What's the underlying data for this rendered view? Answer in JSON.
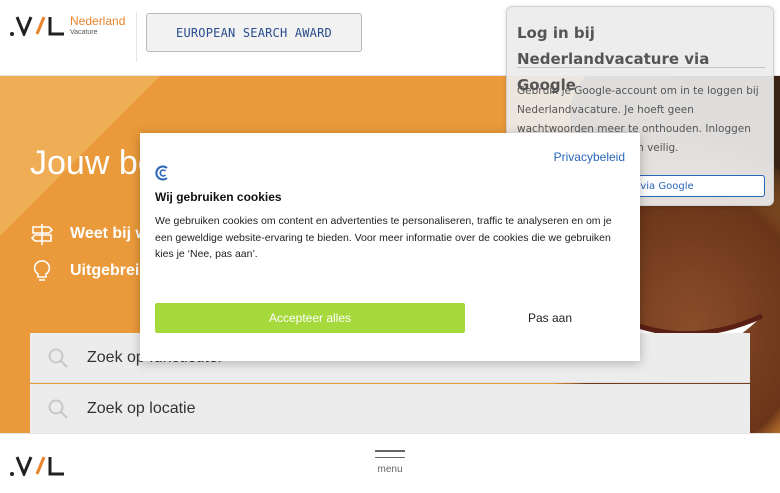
{
  "colors": {
    "brand_orange": "#ea9a3a",
    "accept_green": "#a6d93c",
    "link_blue": "#2a66b8"
  },
  "header": {
    "logo_name": "Nederland",
    "logo_sub": "Vacature",
    "award_button": "EUROPEAN SEARCH AWARD",
    "award_icon_left": "",
    "award_icon_right": ""
  },
  "hero": {
    "title": "Jouw be",
    "row1": "Weet bij w",
    "row2": "Uitgebrei",
    "row1_icon": "signpost-icon",
    "row2_icon": "lightbulb-icon"
  },
  "search": {
    "function_placeholder": "Zoek op functietitel",
    "location_placeholder": "Zoek op locatie"
  },
  "google_popup": {
    "title": "Log in bij Nederlandvacature via Google",
    "close_glyph": "",
    "body": "Gebruik je Google-account om in te loggen bij Nederlandvacature. Je hoeft geen wachtwoorden meer te onthouden. Inloggen gaat snel, eenvoudig en veilig.",
    "button": "Doorgaan via Google"
  },
  "cookie": {
    "privacy_link": "Privacybeleid",
    "title": "Wij gebruiken cookies",
    "body": "We gebruiken cookies om content en advertenties te personaliseren, traffic te analyseren en om je een geweldige website-ervaring te bieden. Voor meer informatie over de cookies die we gebruiken kies je ‘Nee, pas aan’.",
    "accept_button": "Accepteer alles",
    "customize_button": "Pas aan"
  },
  "footer": {
    "menu_label": "menu"
  }
}
